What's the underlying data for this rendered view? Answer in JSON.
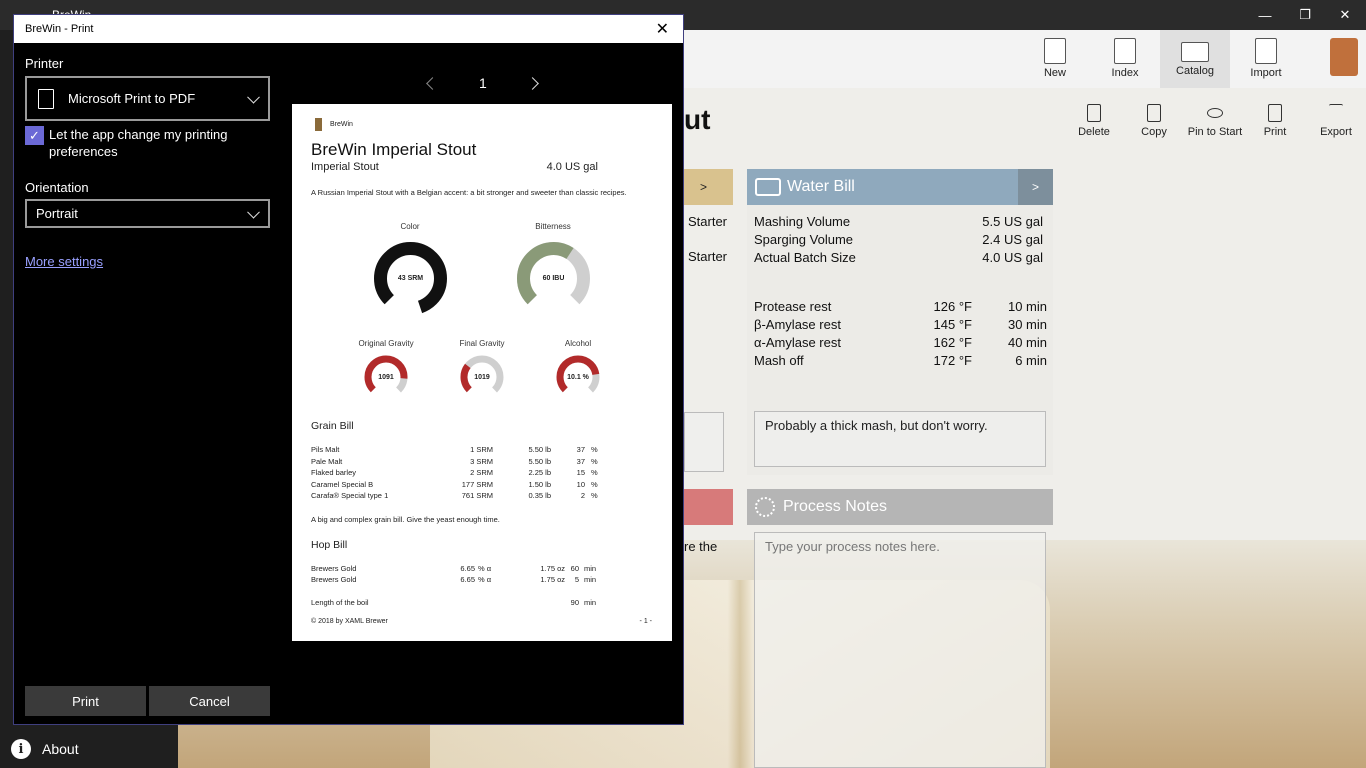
{
  "app": {
    "title": "BreWin",
    "back_glyph": "←",
    "window_controls": {
      "minimize": "—",
      "maximize": "❐",
      "close": "✕"
    },
    "command_bar": [
      {
        "label": "New",
        "icon": "new-page-icon"
      },
      {
        "label": "Index",
        "icon": "notebook-icon"
      },
      {
        "label": "Catalog",
        "icon": "book-icon"
      },
      {
        "label": "Import",
        "icon": "import-icon"
      }
    ],
    "actions": [
      {
        "label": "Delete",
        "icon": "trash-icon"
      },
      {
        "label": "Copy",
        "icon": "copy-icon"
      },
      {
        "label": "Pin to Start",
        "icon": "pin-icon"
      },
      {
        "label": "Print",
        "icon": "print-page-icon"
      },
      {
        "label": "Export",
        "icon": "export-icon"
      }
    ],
    "page_heading_fragment": "ut",
    "left_panel_fragments": [
      "Starter",
      "Starter",
      "re the"
    ],
    "water_bill": {
      "title": "Water Bill",
      "expand": ">",
      "rows": [
        {
          "name": "Mashing Volume",
          "value": "5.5 US gal"
        },
        {
          "name": "Sparging Volume",
          "value": "2.4 US gal"
        },
        {
          "name": "Actual Batch Size",
          "value": "4.0 US gal"
        }
      ],
      "rests": [
        {
          "name": "Protease rest",
          "temp": "126 °F",
          "time": "10 min"
        },
        {
          "name": "β-Amylase rest",
          "temp": "145 °F",
          "time": "30 min"
        },
        {
          "name": "α-Amylase rest",
          "temp": "162 °F",
          "time": "40 min"
        },
        {
          "name": "Mash off",
          "temp": "172 °F",
          "time": "6 min"
        }
      ],
      "note": "Probably a thick mash, but don't worry."
    },
    "process_notes": {
      "title": "Process Notes",
      "placeholder": "Type your process notes here."
    },
    "about_label": "About",
    "colors": {
      "titlebar": "#2b2b2b",
      "sidebar": "#1f1f1f",
      "water_header": "#6f8fa8",
      "left_header_gold": "#b89a55",
      "left_header_red": "#c24a4a",
      "notes_header": "#8d8d8d"
    }
  },
  "dialog": {
    "title": "BreWin - Print",
    "close_glyph": "✕",
    "printer_label": "Printer",
    "printer_value": "Microsoft Print to PDF",
    "checkbox_label": "Let the app change my printing preferences",
    "checkbox_checked": true,
    "orientation_label": "Orientation",
    "orientation_value": "Portrait",
    "more_settings": "More settings",
    "print_button": "Print",
    "cancel_button": "Cancel",
    "page_number": "1",
    "accent": "#6b69d6"
  },
  "preview": {
    "brand": "BreWin",
    "title": "BreWin Imperial Stout",
    "style": "Imperial Stout",
    "batch": "4.0 US gal",
    "description": "A Russian Imperial Stout with a Belgian accent: a bit stronger and sweeter than classic recipes.",
    "gauges_big": [
      {
        "label": "Color",
        "value": "43 SRM",
        "fill": 0.95,
        "color": "#111111"
      },
      {
        "label": "Bitterness",
        "value": "60 IBU",
        "fill": 0.55,
        "color": "#8a9a78"
      }
    ],
    "gauges_small": [
      {
        "label": "Original Gravity",
        "value": "1091",
        "fill": 0.85,
        "color": "#b22a2a"
      },
      {
        "label": "Final Gravity",
        "value": "1019",
        "fill": 0.3,
        "color": "#b22a2a"
      },
      {
        "label": "Alcohol",
        "value": "10.1 %",
        "fill": 0.8,
        "color": "#b22a2a"
      }
    ],
    "grain_bill_title": "Grain Bill",
    "grains": [
      {
        "name": "Pils Malt",
        "color": "1 SRM",
        "weight": "5.50 lb",
        "pct": "37",
        "unit": "%"
      },
      {
        "name": "Pale Malt",
        "color": "3 SRM",
        "weight": "5.50 lb",
        "pct": "37",
        "unit": "%"
      },
      {
        "name": "Flaked barley",
        "color": "2 SRM",
        "weight": "2.25 lb",
        "pct": "15",
        "unit": "%"
      },
      {
        "name": "Caramel Special B",
        "color": "177 SRM",
        "weight": "1.50 lb",
        "pct": "10",
        "unit": "%"
      },
      {
        "name": "Carafa® Special type 1",
        "color": "761 SRM",
        "weight": "0.35 lb",
        "pct": "2",
        "unit": "%"
      }
    ],
    "grain_note": "A big and complex grain bill. Give the yeast enough time.",
    "hop_bill_title": "Hop Bill",
    "hops": [
      {
        "name": "Brewers Gold",
        "alpha": "6.65",
        "alpha_unit": "% α",
        "weight": "1.75 oz",
        "time": "60",
        "time_unit": "min"
      },
      {
        "name": "Brewers Gold",
        "alpha": "6.65",
        "alpha_unit": "% α",
        "weight": "1.75 oz",
        "time": "5",
        "time_unit": "min"
      }
    ],
    "boil_label": "Length of the boil",
    "boil_value": "90",
    "boil_unit": "min",
    "footer_left": "© 2018 by XAML Brewer",
    "footer_right": "- 1 -"
  }
}
